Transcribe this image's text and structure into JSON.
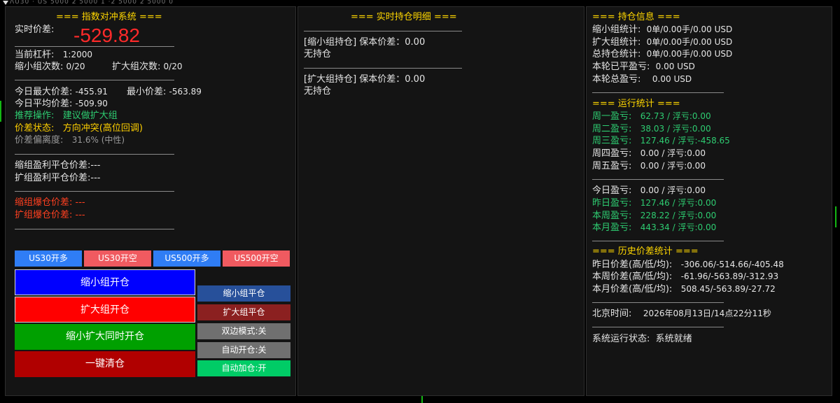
{
  "topbar": {
    "garble": "ɅU30 · US 5000 2 5000 1 ·2 5000 2 5000 0"
  },
  "left": {
    "title": "=== 指数对冲系统 ===",
    "spread_label": "实时价差:",
    "spread_value": "-529.82",
    "leverage_label": "当前杠杆:",
    "leverage_value": "1:2000",
    "shrink_count_label": "缩小组次数:",
    "shrink_count_value": "0/20",
    "expand_count_label": "扩大组次数:",
    "expand_count_value": "0/20",
    "max_spread_label": "今日最大价差:",
    "max_spread_value": "-455.91",
    "min_spread_label": "最小价差:",
    "min_spread_value": "-563.89",
    "avg_spread_label": "今日平均价差:",
    "avg_spread_value": "-509.90",
    "recommend_label": "推荐操作:",
    "recommend_value": "建议做扩大组",
    "state_label": "价差状态:",
    "state_value": "方向冲突(高位回调)",
    "deviation_label": "价差偏离度:",
    "deviation_value": "31.6% (中性)",
    "shrink_tp_label": "缩组盈利平仓价差:",
    "shrink_tp_value": "---",
    "expand_tp_label": "扩组盈利平仓价差:",
    "expand_tp_value": "---",
    "shrink_liq_label": "缩组爆仓价差:",
    "shrink_liq_value": "---",
    "expand_liq_label": "扩组爆仓价差:",
    "expand_liq_value": "---",
    "sep": "------------------------------------------------------------",
    "buttons": {
      "us30_long": "US30开多",
      "us30_short": "US30开空",
      "us500_long": "US500开多",
      "us500_short": "US500开空",
      "open_shrink": "缩小组开仓",
      "open_expand": "扩大组开仓",
      "open_both": "缩小扩大同时开仓",
      "close_all": "一键清仓",
      "close_shrink": "缩小组平仓",
      "close_expand": "扩大组平仓",
      "dual_mode": "双边模式:关",
      "auto_open": "自动开仓:关",
      "auto_add": "自动加仓:开"
    }
  },
  "middle": {
    "title": "=== 实时持仓明细 ===",
    "sep": "------------------------------------------------------------",
    "shrink_header": "[缩小组持仓] 保本价差：0.00",
    "shrink_status": "无持仓",
    "expand_header": "[扩大组持仓] 保本价差：0.00",
    "expand_status": "无持仓"
  },
  "right": {
    "title": "=== 持仓信息 ===",
    "shrink_stat_label": "缩小组统计:",
    "shrink_stat_value": "0单/0.00手/0.00 USD",
    "expand_stat_label": "扩大组统计:",
    "expand_stat_value": "0单/0.00手/0.00 USD",
    "total_stat_label": "总持仓统计:",
    "total_stat_value": "0单/0.00手/0.00 USD",
    "round_closed_label": "本轮已平盈亏:",
    "round_closed_value": "0.00 USD",
    "round_total_label": "本轮总盈亏:",
    "round_total_value": "0.00 USD",
    "sep": "------------------------------------------------------",
    "run_title": "=== 运行统计 ===",
    "days": [
      {
        "label": "周一盈亏:",
        "value": "62.73 / 浮亏:0.00"
      },
      {
        "label": "周二盈亏:",
        "value": "38.03 / 浮亏:0.00"
      },
      {
        "label": "周三盈亏:",
        "value": "127.46 / 浮亏:-458.65"
      },
      {
        "label": "周四盈亏:",
        "value": "0.00 / 浮亏:0.00"
      },
      {
        "label": "周五盈亏:",
        "value": "0.00 / 浮亏:0.00"
      }
    ],
    "periods": [
      {
        "label": "今日盈亏:",
        "value": "0.00 / 浮亏:0.00"
      },
      {
        "label": "昨日盈亏:",
        "value": "127.46 / 浮亏:0.00"
      },
      {
        "label": "本周盈亏:",
        "value": "228.22 / 浮亏:0.00"
      },
      {
        "label": "本月盈亏:",
        "value": "443.34 / 浮亏:0.00"
      }
    ],
    "hist_title": "=== 历史价差统计 ===",
    "hist": [
      {
        "label": "昨日价差(高/低/均):",
        "value": "-306.06/-514.66/-405.48"
      },
      {
        "label": "本周价差(高/低/均):",
        "value": "-61.96/-563.89/-312.93"
      },
      {
        "label": "本月价差(高/低/均):",
        "value": "508.45/-563.89/-27.72"
      }
    ],
    "time_label": "北京时间:",
    "time_value": "2026年08月13日/14点22分11秒",
    "status_label": "系统运行状态:",
    "status_value": "系统就绪"
  },
  "colors": {
    "title": "#ffd700",
    "spread": "#ff2a2a",
    "profit_green": "#2ecc71",
    "warn_yellow": "#ffd000",
    "liq_red": "#ff4020",
    "btn_blue": "#2f7df5",
    "btn_red_light": "#f05a60",
    "btn_shrink": "#0000ff",
    "btn_expand": "#ff0000",
    "btn_both": "#00a000",
    "btn_clear": "#b00000",
    "btn_close_shrink": "#27509a",
    "btn_close_expand": "#8b2020",
    "btn_gray": "#707070",
    "btn_auto_add": "#00cc66"
  }
}
